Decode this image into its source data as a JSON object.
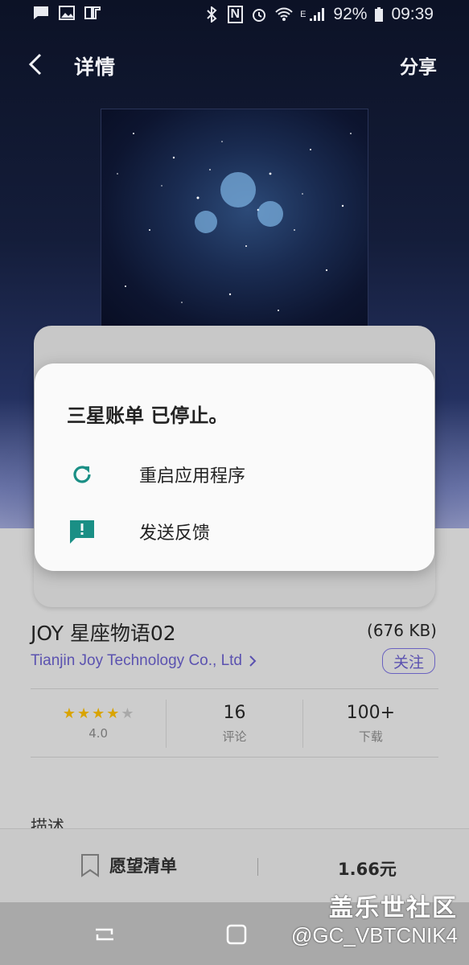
{
  "status_bar": {
    "battery": "92%",
    "time": "09:39",
    "signal_letter": "E",
    "nfc_letter": "N"
  },
  "app_bar": {
    "title": "详情",
    "share_label": "分享"
  },
  "app": {
    "name": "JOY 星座物语02",
    "size": "(676 KB)",
    "developer": "Tianjin Joy Technology Co., Ltd",
    "follow_label": "关注",
    "rating_value": "4.0",
    "rating_stars": 4,
    "reviews_count": "16",
    "reviews_label": "评论",
    "downloads_count": "100+",
    "downloads_label": "下载",
    "description_title": "描述"
  },
  "buy_bar": {
    "wishlist_label": "愿望清单",
    "price": "1.66元"
  },
  "dialog": {
    "title": "三星账单 已停止。",
    "options": [
      {
        "label": "重启应用程序",
        "icon": "restart-icon"
      },
      {
        "label": "发送反馈",
        "icon": "feedback-icon"
      }
    ]
  },
  "watermark": {
    "line1": "盖乐世社区",
    "line2": "@GC_VBTCNIK4"
  },
  "colors": {
    "accent_teal": "#1a8f85",
    "link_purple": "#5b52b0",
    "star_gold": "#d9a400"
  }
}
